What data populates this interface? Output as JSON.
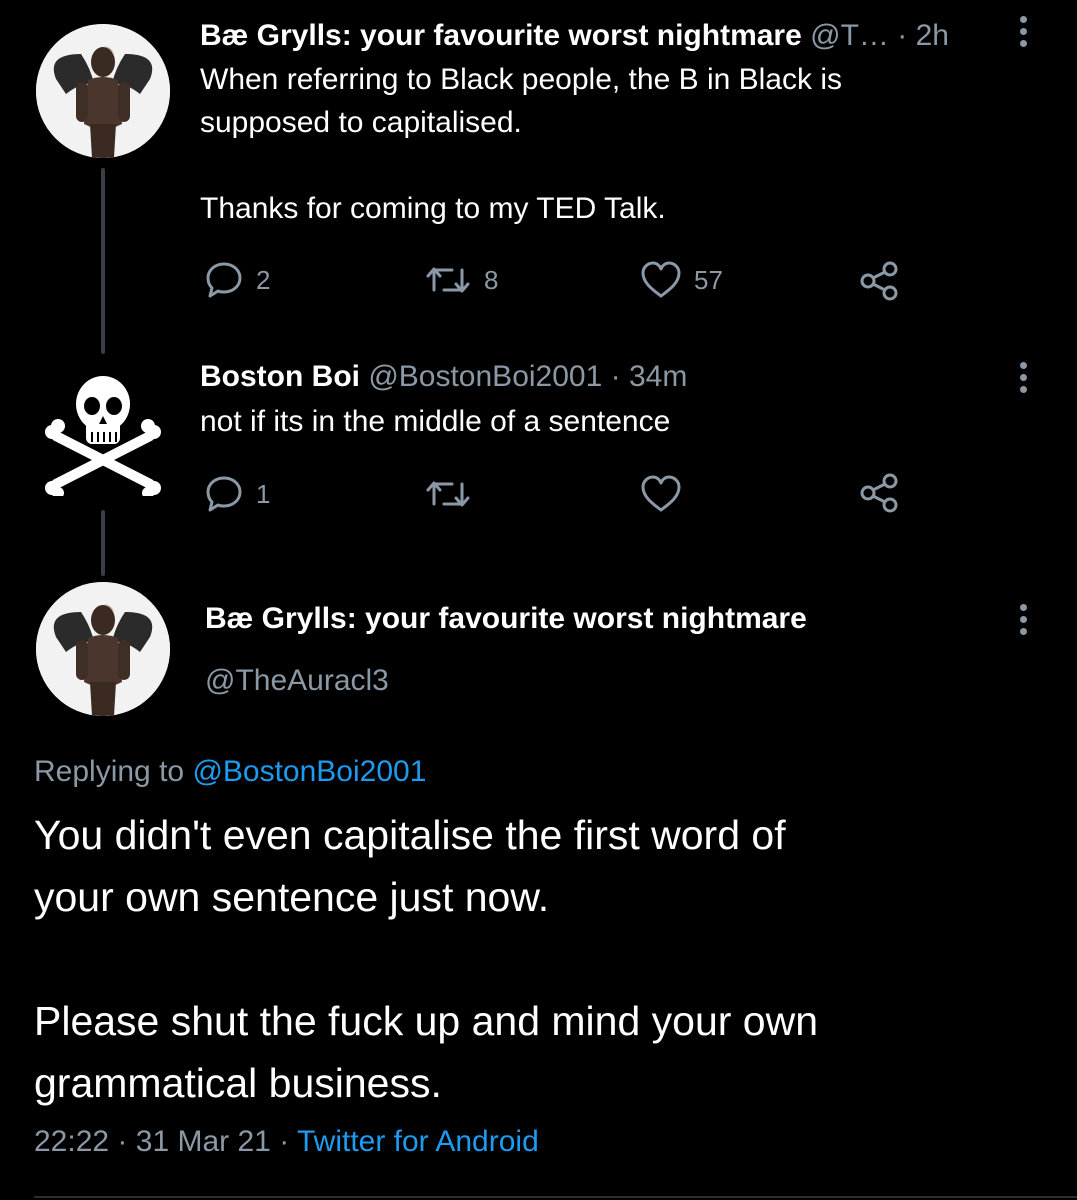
{
  "tweets": [
    {
      "name": "Bæ Grylls: your favourite worst nightmare",
      "handle": "@T…",
      "time": "· 2h",
      "text": "When referring to Black people, the B in Black is\nsupposed to capitalised.\n\nThanks for coming to my TED Talk.",
      "replies": "2",
      "retweets": "8",
      "likes": "57"
    },
    {
      "name": "Boston Boi",
      "handle": "@BostonBoi2001",
      "time": "· 34m",
      "text": "not if its in the middle of a sentence",
      "replies": "1",
      "retweets": "",
      "likes": ""
    }
  ],
  "main_tweet": {
    "name": "Bæ Grylls: your favourite worst nightmare",
    "handle": "@TheAuracl3",
    "replying_prefix": "Replying to",
    "replying_to": "@BostonBoi2001",
    "text": "You didn't even capitalise the first word of\nyour own sentence just now.\n\nPlease shut the fuck up and mind your own\ngrammatical business.",
    "time": "22:22",
    "date": "31 Mar 21",
    "source": "Twitter for Android"
  },
  "icons": {
    "reply": "reply-icon",
    "retweet": "retweet-icon",
    "like": "heart-icon",
    "share": "share-icon",
    "more": "more-vertical-icon"
  },
  "colors": {
    "background": "#000000",
    "text": "#ffffff",
    "muted": "#8b98a5",
    "link": "#1d9bf0"
  }
}
